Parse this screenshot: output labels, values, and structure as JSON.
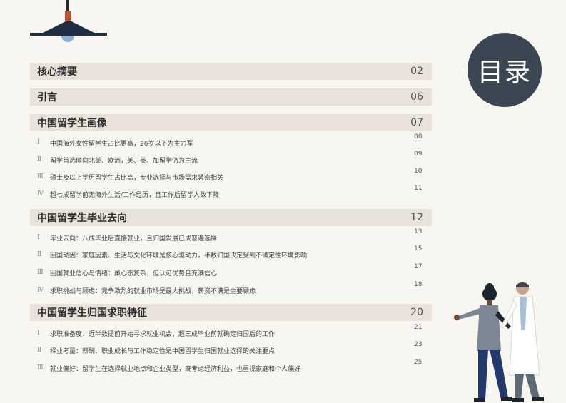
{
  "header": {
    "title": "目录"
  },
  "icons": {
    "lamp": "hanging-lamp-icon",
    "illustration": "two-people-illustration"
  },
  "colors": {
    "bar_bg": "#e8e2db",
    "circle_bg": "#3b4652",
    "lamp_shade": "#1f2e45",
    "lamp_bulb": "#8fb0d8",
    "lamp_cord": "#c0512f"
  },
  "toc": [
    {
      "title": "核心摘要",
      "page": "02",
      "items": []
    },
    {
      "title": "引言",
      "page": "06",
      "items": []
    },
    {
      "title": "中国留学生画像",
      "page": "07",
      "items": [
        {
          "num": "Ⅰ",
          "text": "中国海外女性留学生占比更高，26岁以下为主力军",
          "page": "08"
        },
        {
          "num": "Ⅱ",
          "text": "留学首选倾向北美、欧洲，美、英、加留学仍为主流",
          "page": "09"
        },
        {
          "num": "Ⅲ",
          "text": "硕士及以上学历留学生占比高，专业选择与市场需求紧密相关",
          "page": "10"
        },
        {
          "num": "Ⅳ",
          "text": "超七成留学前无海外生活/工作经历，且工作后留学人数下降",
          "page": "11"
        }
      ]
    },
    {
      "title": "中国留学生毕业去向",
      "page": "12",
      "items": [
        {
          "num": "Ⅰ",
          "text": "毕业去向：八成毕业后直接就业，且归国发展已成普遍选择",
          "page": "13"
        },
        {
          "num": "Ⅱ",
          "text": "回国动因：家庭因素、生活与文化环境是核心驱动力，半数归国决定受到不确定性环境影响",
          "page": "15"
        },
        {
          "num": "Ⅲ",
          "text": "回国就业信心与情绪：虽心态复杂，但认可优势且充满信心",
          "page": "17"
        },
        {
          "num": "Ⅳ",
          "text": "求职挑战与顾虑：竞争激烈的就业市场是最大挑战，薪资不满是主要顾虑",
          "page": "18"
        }
      ]
    },
    {
      "title": "中国留学生归国求职特征",
      "page": "20",
      "items": [
        {
          "num": "Ⅰ",
          "text": "求职准备度：近半数提前开始寻求就业机会，超三成毕业前就确定归国后的工作",
          "page": "21"
        },
        {
          "num": "Ⅱ",
          "text": "择业考量：薪酬、职业成长与工作稳定性是中国留学生归国就业选择的关注要点",
          "page": "23"
        },
        {
          "num": "Ⅲ",
          "text": "就业偏好：留学生在选择就业地点和企业类型，既考虑经济利益，也重视家庭和个人偏好",
          "page": "25"
        }
      ]
    }
  ]
}
